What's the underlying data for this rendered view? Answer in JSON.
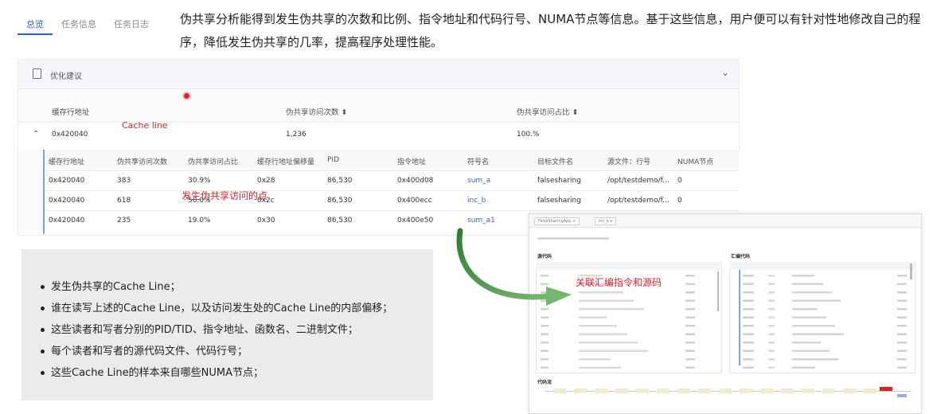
{
  "tabs": [
    "总览",
    "任务信息",
    "任务日志"
  ],
  "heading": "伪共享分析能得到发生伪共享的次数和比例、指令地址和代码行号、NUMA节点等信息。基于这些信息，用户便可以有针对性地修改自己的程序，降低发生伪共享的几率，提高程序处理性能。",
  "optimization_label": "优化建议",
  "outer_table": {
    "headers": [
      "缓存行地址",
      "伪共享访问次数",
      "伪共享访问占比"
    ],
    "row": {
      "address": "0x420040",
      "count": "1,236",
      "ratio": "100.%"
    }
  },
  "annotation_cache_line": "Cache line",
  "annotation_points": "发生伪共享访问的点",
  "annotation_link": "关联汇编指令和源码",
  "inner_table": {
    "headers": [
      "缓存行地址",
      "伪共享访问次数",
      "伪共享访问占比",
      "缓存行地址偏移量",
      "PID",
      "指令地址",
      "符号名",
      "目标文件名",
      "源文件：行号",
      "NUMA节点"
    ],
    "rows": [
      [
        "0x420040",
        "383",
        "30.9%",
        "0x28",
        "86,530",
        "0x400d08",
        "sum_a",
        "falsesharing",
        "/opt/testdemo/f...",
        "0"
      ],
      [
        "0x420040",
        "618",
        "50.0%",
        "0x2c",
        "86,530",
        "0x400ecc",
        "inc_b",
        "falsesharing",
        "/opt/testdemo/f...",
        "0"
      ],
      [
        "0x420040",
        "235",
        "19.0%",
        "0x30",
        "86,530",
        "0x400e50",
        "sum_a1",
        "",
        "",
        ""
      ]
    ]
  },
  "bullets": [
    "发生伪共享的Cache Line；",
    "谁在读写上述的Cache Line，以及访问发生处的Cache Line的内部偏移；",
    "这些读者和写者分别的PID/TID、指令地址、函数名、二进制文件；",
    "每个读者和写者的源代码文件、代码行号；",
    "这些Cache Line的样本来自哪些NUMA节点；"
  ],
  "screenshot": {
    "tab1": "FalseSharingApp",
    "tab2": "inc_b",
    "source_title": "源代码",
    "asm_title": "汇编代码",
    "flow_title": "代码流"
  },
  "colors": {
    "accent": "#2b5fd0",
    "annotation": "#d8242a",
    "arrow": "#2e7d32"
  }
}
